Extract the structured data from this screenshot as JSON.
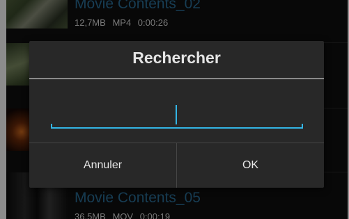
{
  "list": {
    "items": [
      {
        "title": "Movie Contents_02",
        "size": "12,7MB",
        "format": "MP4",
        "duration": "0:00:26"
      },
      {
        "title": "Movie Contents_05",
        "size": "36,5MB",
        "format": "MOV",
        "duration": "0:00:19"
      }
    ]
  },
  "dialog": {
    "title": "Rechercher",
    "search_value": "",
    "cancel_label": "Annuler",
    "ok_label": "OK"
  },
  "colors": {
    "accent": "#33b5e5",
    "dialog_bg": "#282828",
    "list_title": "#2b6f99"
  }
}
